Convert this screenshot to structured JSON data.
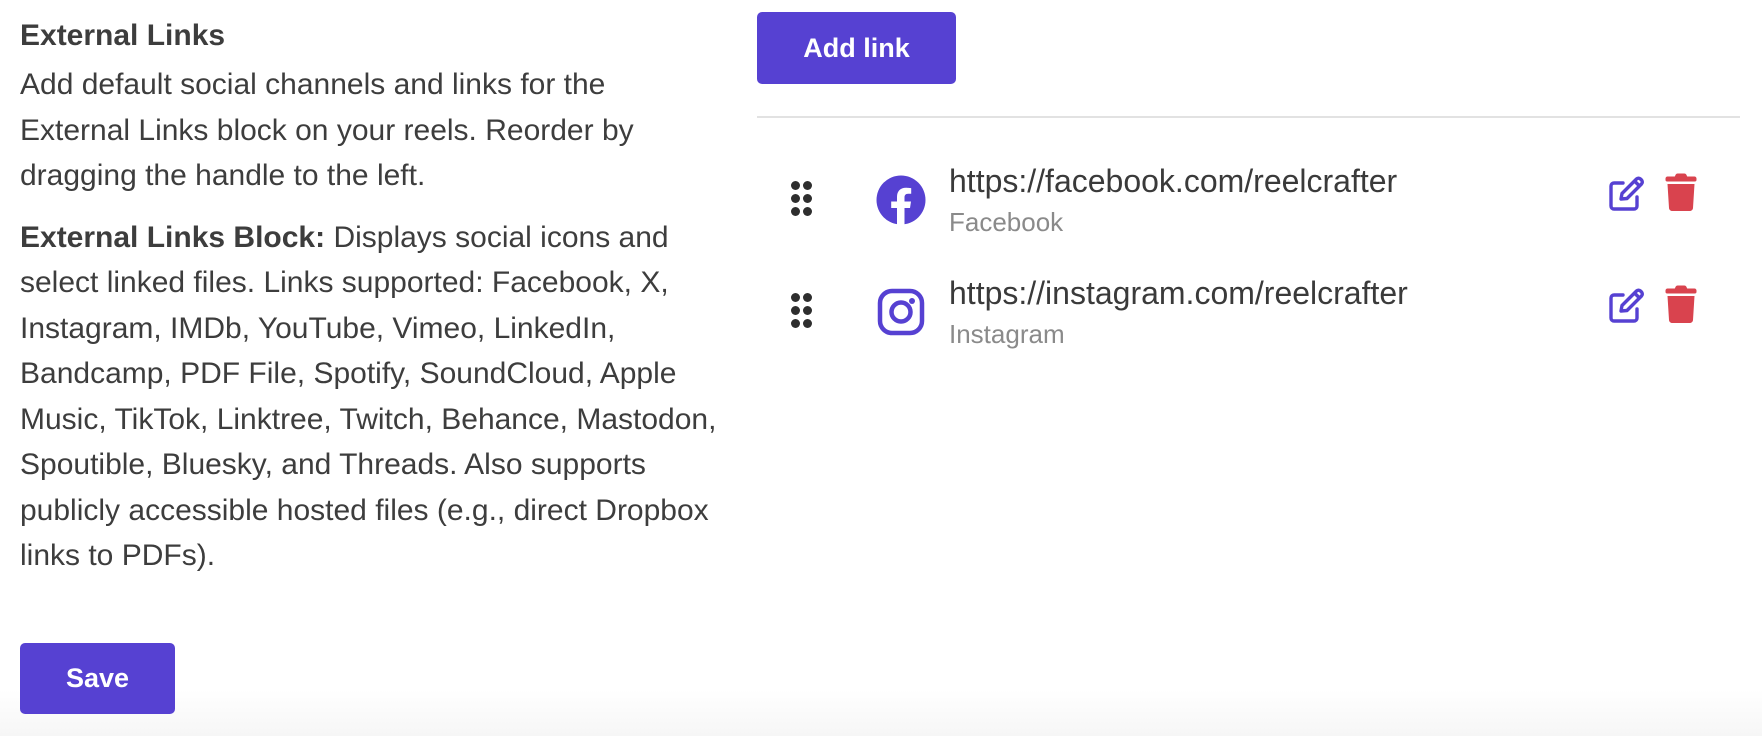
{
  "section": {
    "title": "External Links",
    "description": "Add default social channels and links for the External Links block on your reels. Reorder by dragging the handle to the left.",
    "block_label": "External Links Block:",
    "block_description": " Displays social icons and select linked files. Links supported: Facebook, X, Instagram, IMDb, YouTube, Vimeo, LinkedIn, Bandcamp, PDF File, Spotify, SoundCloud, Apple Music, TikTok, Linktree, Twitch, Behance, Mastodon, Spoutible, Bluesky, and Threads. Also supports publicly accessible hosted files (e.g., direct Dropbox links to PDFs)."
  },
  "actions": {
    "save_label": "Save",
    "add_link_label": "Add link"
  },
  "links": [
    {
      "url": "https://facebook.com/reelcrafter",
      "name": "Facebook",
      "icon": "facebook-icon"
    },
    {
      "url": "https://instagram.com/reelcrafter",
      "name": "Instagram",
      "icon": "instagram-icon"
    }
  ],
  "colors": {
    "accent": "#5641d2",
    "danger": "#d9434e",
    "text": "#3d3d3d",
    "muted": "#8a8a8a"
  }
}
